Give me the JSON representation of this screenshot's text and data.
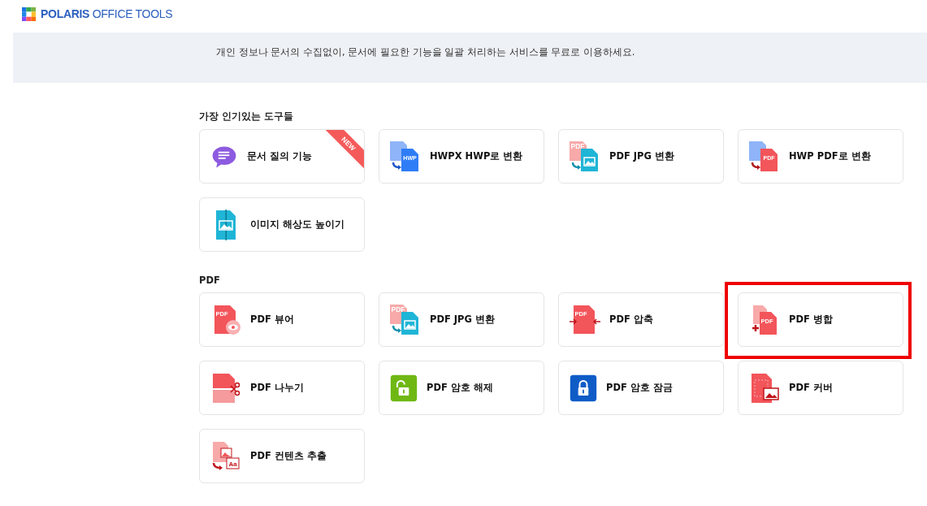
{
  "header": {
    "logo_bold": "POLARIS",
    "logo_light": "OFFICE TOOLS"
  },
  "banner": {
    "text": "개인 정보나 문서의 수집없이, 문서에 필요한 기능을 일괄 처리하는 서비스를 무료로 이용하세요."
  },
  "sections": [
    {
      "title": "가장 인기있는 도구들",
      "tools": [
        {
          "label": "문서 질의 기능",
          "kind": "chat",
          "badge": "NEW",
          "highlighted": false
        },
        {
          "label": "HWPX HWP로 변환",
          "kind": "convert-blue",
          "icon_text": "HWP",
          "highlighted": false
        },
        {
          "label": "PDF JPG 변환",
          "kind": "convert-image",
          "icon_text": "PDF",
          "highlighted": false
        },
        {
          "label": "HWP PDF로 변환",
          "kind": "convert-red",
          "icon_text": "PDF",
          "highlighted": false
        },
        {
          "label": "이미지 해상도 높이기",
          "kind": "upscale",
          "highlighted": false
        }
      ]
    },
    {
      "title": "PDF",
      "tools": [
        {
          "label": "PDF 뷰어",
          "kind": "view",
          "icon_text": "PDF",
          "highlighted": false
        },
        {
          "label": "PDF JPG 변환",
          "kind": "convert-image",
          "icon_text": "PDF",
          "highlighted": false
        },
        {
          "label": "PDF 압축",
          "kind": "compress",
          "icon_text": "PDF",
          "highlighted": false
        },
        {
          "label": "PDF 병합",
          "kind": "merge",
          "icon_text": "PDF",
          "highlighted": true
        },
        {
          "label": "PDF 나누기",
          "kind": "split",
          "highlighted": false
        },
        {
          "label": "PDF 암호 해제",
          "kind": "unlock",
          "highlighted": false
        },
        {
          "label": "PDF 암호 잠금",
          "kind": "lock",
          "highlighted": false
        },
        {
          "label": "PDF 커버",
          "kind": "cover",
          "highlighted": false
        },
        {
          "label": "PDF 컨텐츠 추출",
          "kind": "extract",
          "icon_text": "Aa",
          "highlighted": false
        }
      ]
    }
  ]
}
